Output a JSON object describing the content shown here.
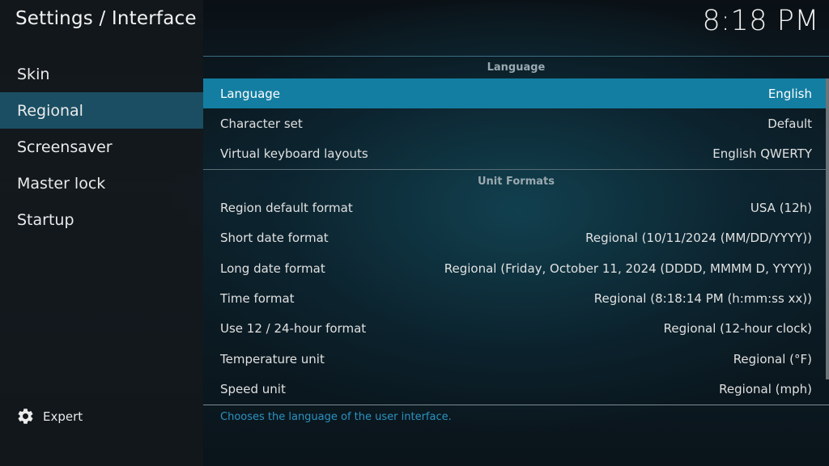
{
  "header": {
    "title": "Settings / Interface",
    "clock": "8:18 PM"
  },
  "sidebar": {
    "items": [
      {
        "label": "Skin",
        "active": false
      },
      {
        "label": "Regional",
        "active": true
      },
      {
        "label": "Screensaver",
        "active": false
      },
      {
        "label": "Master lock",
        "active": false
      },
      {
        "label": "Startup",
        "active": false
      }
    ],
    "expert_label": "Expert"
  },
  "sections": {
    "language": {
      "header": "Language",
      "rows": [
        {
          "label": "Language",
          "value": "English"
        },
        {
          "label": "Character set",
          "value": "Default"
        },
        {
          "label": "Virtual keyboard layouts",
          "value": "English QWERTY"
        }
      ]
    },
    "unit_formats": {
      "header": "Unit Formats",
      "rows": [
        {
          "label": "Region default format",
          "value": "USA (12h)"
        },
        {
          "label": "Short date format",
          "value": "Regional (10/11/2024 (MM/DD/YYYY))"
        },
        {
          "label": "Long date format",
          "value": "Regional (Friday, October 11, 2024 (DDDD, MMMM D, YYYY))"
        },
        {
          "label": "Time format",
          "value": "Regional (8:18:14 PM (h:mm:ss xx))"
        },
        {
          "label": "Use 12 / 24-hour format",
          "value": "Regional (12-hour clock)"
        },
        {
          "label": "Temperature unit",
          "value": "Regional (°F)"
        },
        {
          "label": "Speed unit",
          "value": "Regional (mph)"
        }
      ]
    }
  },
  "description": "Chooses the language of the user interface.",
  "colors": {
    "selected_row": "#137ea1",
    "active_nav": "#1b4e63",
    "description_text": "#2b93c2"
  },
  "icons": {
    "expert": "gear-icon"
  }
}
